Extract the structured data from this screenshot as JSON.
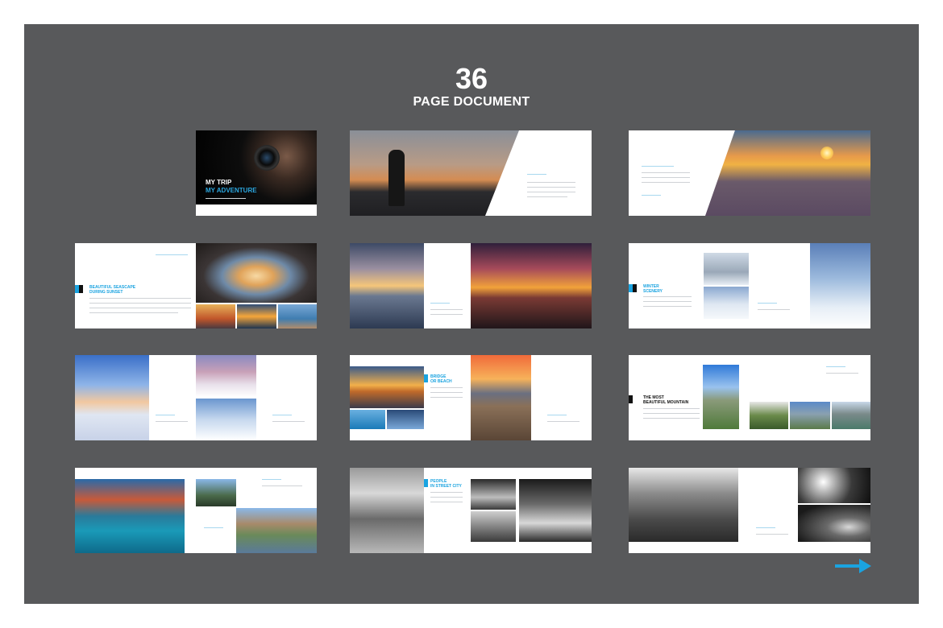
{
  "header": {
    "count": "36",
    "label": "PAGE DOCUMENT"
  },
  "colors": {
    "stage_bg": "#58595b",
    "accent": "#1aa3e0"
  },
  "spreads": {
    "cover": {
      "title_line1": "MY TRIP",
      "title_line2": "MY ADVENTURE"
    },
    "s1_3": {
      "title_line1": "BEAUTIFUL SEASCAPE",
      "title_line2": "DURING SUNSET"
    },
    "s2_3": {
      "title_line1": "WINTER",
      "title_line2": "SCENERY"
    },
    "s3_2": {
      "title_line1": "BRIDGE",
      "title_line2": "OR BEACH"
    },
    "s3_3": {
      "title_line1": "THE MOST",
      "title_line2": "BEAUTIFUL MOUNTAIN"
    },
    "s4_2": {
      "title_line1": "PEOPLE",
      "title_line2": "IN STREET CITY"
    }
  },
  "icons": {
    "next": "arrow-right-icon"
  }
}
